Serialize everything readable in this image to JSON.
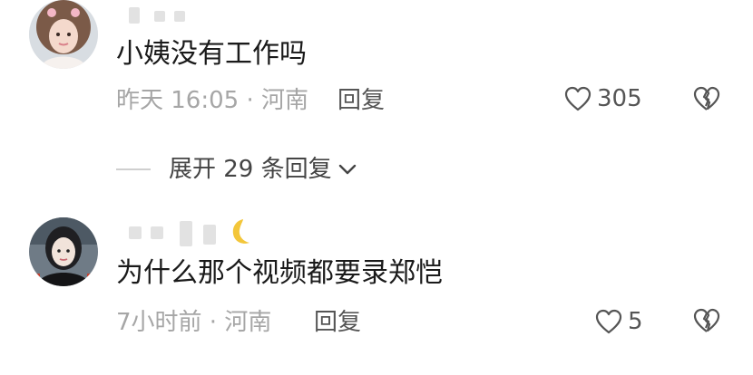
{
  "comments": [
    {
      "text": "小姨没有工作吗",
      "time": "昨天 16:05",
      "location": "河南",
      "reply_label": "回复",
      "likes": "305",
      "expand_label": "展开 29 条回复"
    },
    {
      "text": "为什么那个视频都要录郑恺",
      "time": "7小时前",
      "location": "河南",
      "reply_label": "回复",
      "likes": "5"
    }
  ],
  "separator": " · ",
  "icons": {
    "like": "heart-outline-icon",
    "dislike": "broken-heart-icon",
    "expand": "chevron-down-icon",
    "badge": "crescent-moon-icon"
  },
  "colors": {
    "text": "#1a1a1a",
    "meta": "#a6a6a6",
    "action": "#555555",
    "moon": "#f3c63a"
  }
}
